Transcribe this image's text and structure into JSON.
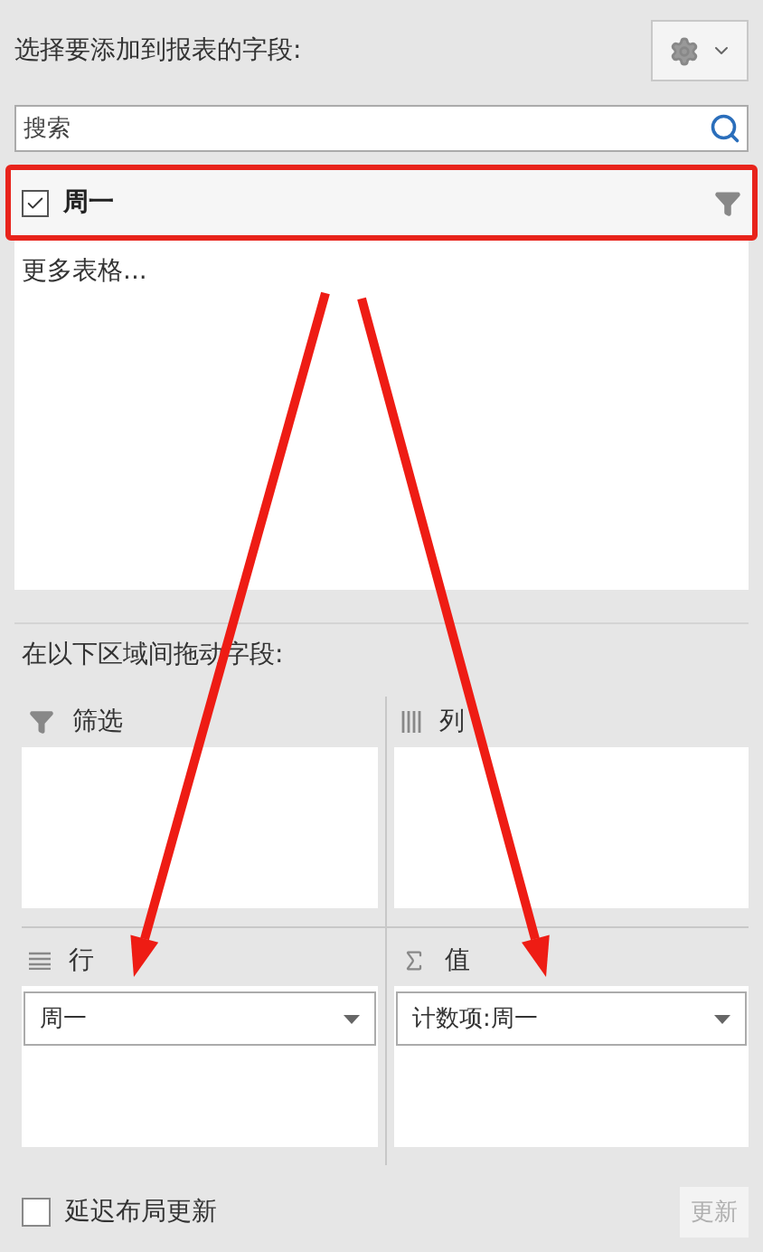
{
  "header": {
    "title": "选择要添加到报表的字段:"
  },
  "search": {
    "placeholder": "搜索"
  },
  "fields": [
    {
      "label": "周一",
      "checked": true,
      "highlighted": true
    }
  ],
  "more_tables": "更多表格...",
  "areas_title": "在以下区域间拖动字段:",
  "areas": [
    {
      "kind": "filter",
      "title": "筛选"
    },
    {
      "kind": "columns",
      "title": "列"
    },
    {
      "kind": "rows",
      "title": "行",
      "items": [
        {
          "label": "周一"
        }
      ]
    },
    {
      "kind": "values",
      "title": "值",
      "items": [
        {
          "label": "计数项:周一"
        }
      ]
    }
  ],
  "defer": {
    "label": "延迟布局更新",
    "checked": false
  },
  "update_button": {
    "label": "更新",
    "disabled": true
  }
}
